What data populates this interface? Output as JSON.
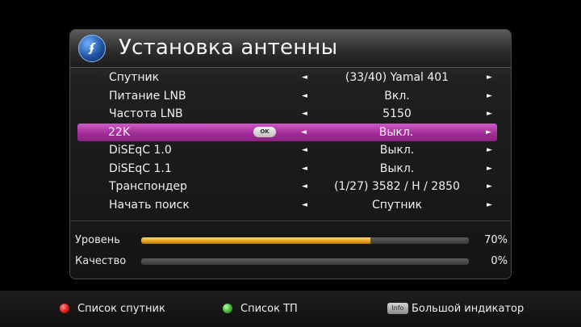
{
  "header": {
    "title": "Установка антенны",
    "logo_icon": "brand-logo-icon"
  },
  "menu": {
    "items": [
      {
        "label": "Спутник",
        "value": "(33/40) Yamal 401"
      },
      {
        "label": "Питание LNB",
        "value": "Вкл."
      },
      {
        "label": "Частота LNB",
        "value": "5150"
      },
      {
        "label": "22K",
        "value": "Выкл.",
        "selected": true,
        "ok_label": "OK"
      },
      {
        "label": "DiSEqC 1.0",
        "value": "Выкл."
      },
      {
        "label": "DiSEqC 1.1",
        "value": "Выкл."
      },
      {
        "label": "Транспондер",
        "value": "(1/27) 3582 / H / 2850"
      },
      {
        "label": "Начать поиск",
        "value": "Спутник"
      }
    ],
    "arrow_left": "◄",
    "arrow_right": "►",
    "selected_color": "#b13aa6"
  },
  "signal": {
    "level": {
      "label": "Уровень",
      "percent_text": "70%",
      "value": 70,
      "color": "#e6a41e"
    },
    "quality": {
      "label": "Качество",
      "percent_text": "0%",
      "value": 0
    }
  },
  "footer": {
    "red_label": "Список спутник",
    "green_label": "Список ТП",
    "info_key": "Info",
    "info_label": "Большой индикатор"
  }
}
